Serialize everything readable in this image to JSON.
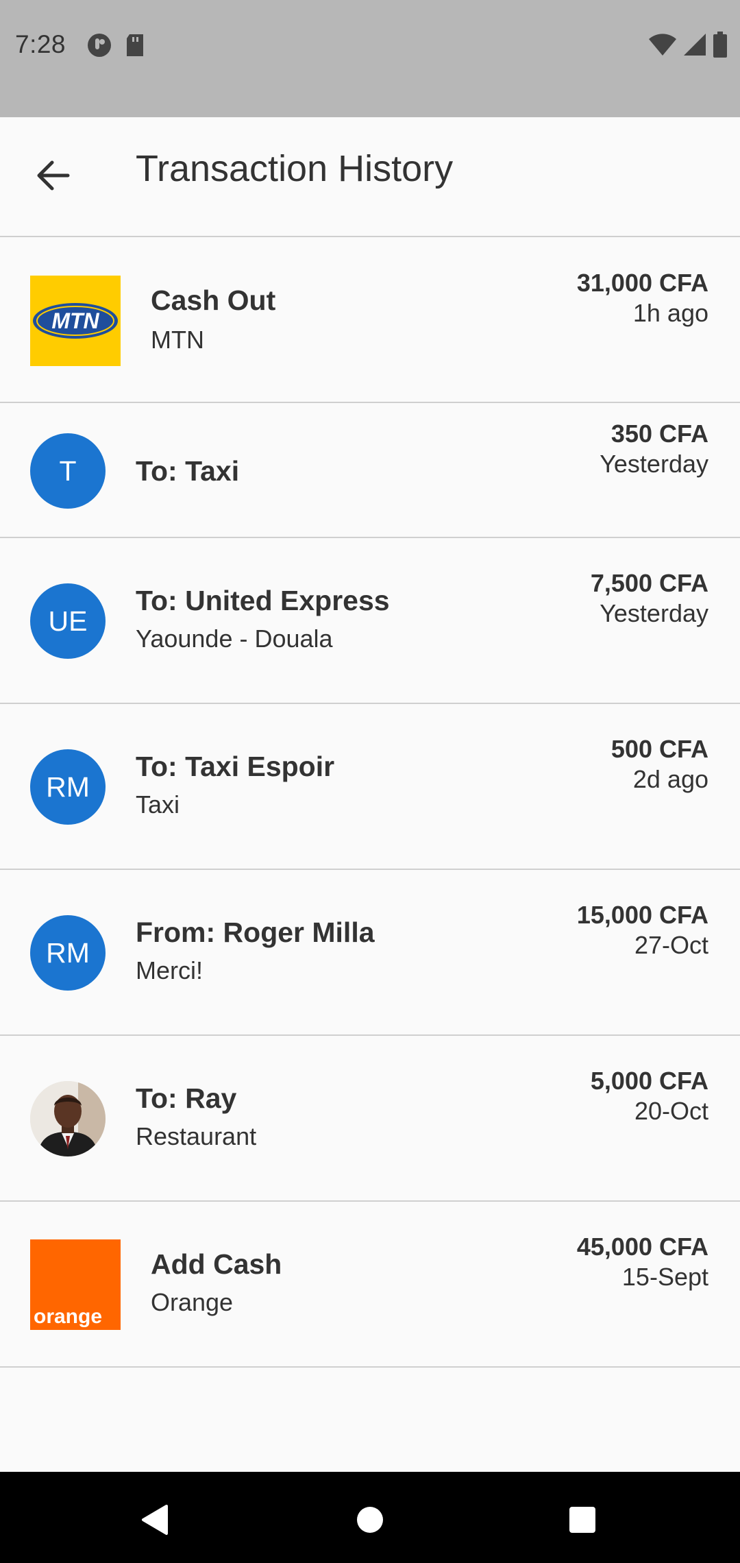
{
  "status_bar": {
    "time": "7:28",
    "icons_left": [
      "data-saver-icon",
      "sd-card-icon"
    ],
    "icons_right": [
      "wifi-icon",
      "signal-icon",
      "battery-icon"
    ]
  },
  "app_bar": {
    "back_icon": "arrow-left-icon",
    "title": "Transaction History"
  },
  "transactions": [
    {
      "avatar_type": "logo",
      "logo": "mtn-logo",
      "logo_text": "MTN",
      "title": "Cash Out",
      "subtitle": "MTN",
      "amount": "31,000 CFA",
      "time": "1h ago"
    },
    {
      "avatar_type": "initials",
      "initials": "T",
      "title": "To: Taxi",
      "subtitle": "",
      "amount": "350 CFA",
      "time": "Yesterday"
    },
    {
      "avatar_type": "initials",
      "initials": "UE",
      "title": "To: United Express",
      "subtitle": "Yaounde - Douala",
      "amount": "7,500 CFA",
      "time": "Yesterday"
    },
    {
      "avatar_type": "initials",
      "initials": "RM",
      "title": "To: Taxi Espoir",
      "subtitle": "Taxi",
      "amount": "500 CFA",
      "time": "2d ago"
    },
    {
      "avatar_type": "initials",
      "initials": "RM",
      "title": "From: Roger Milla",
      "subtitle": "Merci!",
      "amount": "15,000 CFA",
      "time": "27-Oct"
    },
    {
      "avatar_type": "photo",
      "title": "To: Ray",
      "subtitle": "Restaurant",
      "amount": "5,000 CFA",
      "time": "20-Oct"
    },
    {
      "avatar_type": "logo",
      "logo": "orange-logo",
      "logo_text": "orange",
      "title": "Add Cash",
      "subtitle": "Orange",
      "amount": "45,000 CFA",
      "time": "15-Sept"
    }
  ],
  "colors": {
    "status_bar_bg": "#b7b7b7",
    "avatar_blue": "#1b75d0",
    "mtn_yellow": "#ffcc00",
    "mtn_blue": "#1f4e9c",
    "orange_brand": "#ff6600",
    "nav_bar_bg": "#000000"
  },
  "nav_bar": {
    "icons": [
      "back-triangle-icon",
      "home-circle-icon",
      "recents-square-icon"
    ]
  }
}
